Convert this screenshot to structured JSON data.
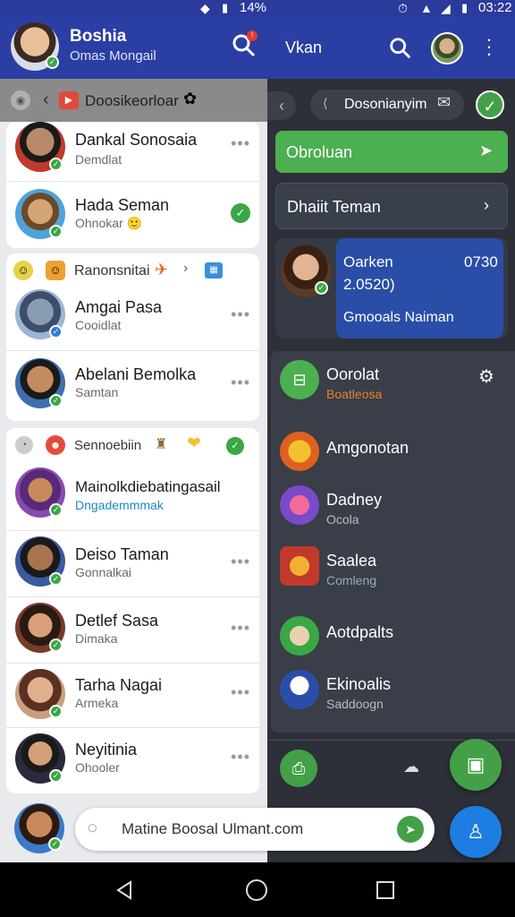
{
  "status_bar": {
    "battery_pct": "14%",
    "time": "03:22"
  },
  "left_header": {
    "name": "Boshia",
    "subtitle": "Omas Mongail"
  },
  "right_header": {
    "title": "Vkan"
  },
  "left_search": {
    "text": "Doosikeorloar"
  },
  "contacts_group1": [
    {
      "name": "Dankal Sonosaia",
      "sub": "Demdlat"
    },
    {
      "name": "Hada Seman",
      "sub": "Ohnokar 🙂"
    }
  ],
  "group2": {
    "title": "Ranonsnitai"
  },
  "contacts_group2": [
    {
      "name": "Amgai Pasa",
      "sub": "Cooidlat"
    },
    {
      "name": "Abelani Bemolka",
      "sub": "Samtan"
    }
  ],
  "group3": {
    "title": "Sennoebiin"
  },
  "contacts_group3": [
    {
      "name": "Mainolkdiebatingasail",
      "sub": "Dngademmmak"
    },
    {
      "name": "Deiso Taman",
      "sub": "Gonnalkai"
    },
    {
      "name": "Detlef Sasa",
      "sub": "Dimaka"
    },
    {
      "name": "Tarha Nagai",
      "sub": "Armeka"
    },
    {
      "name": "Neyitinia",
      "sub": "Ohooler"
    }
  ],
  "bottom_search": {
    "text": "Matine Boosal Ulmant.com"
  },
  "right_search": {
    "text": "Dosonianyim"
  },
  "green_button": {
    "label": "Obroluan"
  },
  "dark_button": {
    "label": "Dhaiit Teman"
  },
  "profile_card": {
    "name": "Oarken",
    "time": "0730",
    "phone": "2.0520)",
    "action": "Gmooals Naiman"
  },
  "menu": [
    {
      "title": "Oorolat",
      "sub": "Boatleosa"
    },
    {
      "title": "Amgonotan",
      "sub": ""
    },
    {
      "title": "Dadney",
      "sub": "Ocola"
    },
    {
      "title": "Saalea",
      "sub": "Comleng"
    },
    {
      "title": "Aotdpalts",
      "sub": ""
    },
    {
      "title": "Ekinoalis",
      "sub": "Saddoogn"
    }
  ],
  "colors": {
    "primary": "#2b3ea3",
    "green": "#4caf50",
    "dark": "#2d3038",
    "accent_blue": "#2a4ea8"
  }
}
